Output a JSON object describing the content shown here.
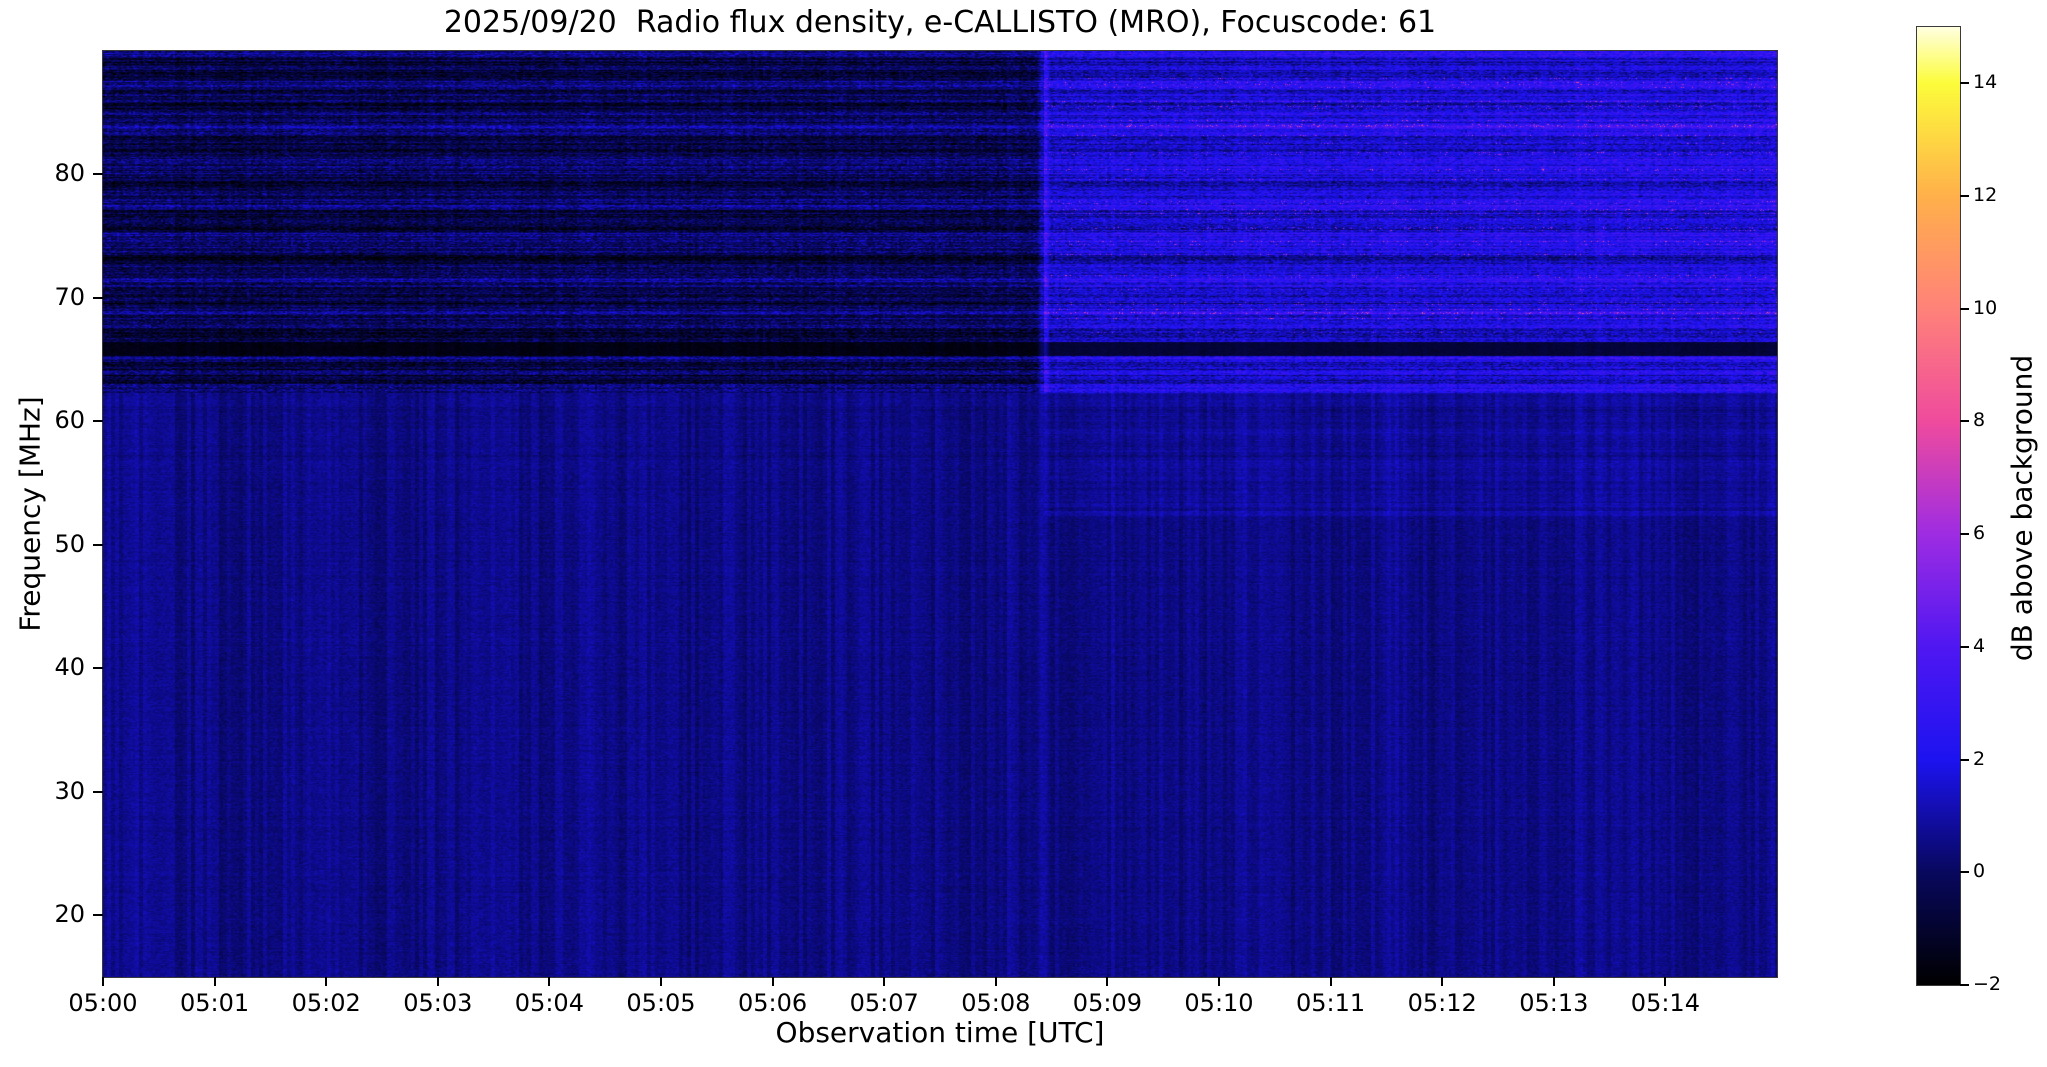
{
  "chart_data": {
    "type": "heatmap",
    "title": "2025/09/20  Radio flux density, e-CALLISTO (MRO), Focuscode: 61",
    "xlabel": "Observation time [UTC]",
    "ylabel": "Frequency [MHz]",
    "x_range_minutes": [
      0,
      15
    ],
    "x_start_time": "05:00",
    "x_ticks": [
      {
        "minute": 0,
        "label": "05:00"
      },
      {
        "minute": 1,
        "label": "05:01"
      },
      {
        "minute": 2,
        "label": "05:02"
      },
      {
        "minute": 3,
        "label": "05:03"
      },
      {
        "minute": 4,
        "label": "05:04"
      },
      {
        "minute": 5,
        "label": "05:05"
      },
      {
        "minute": 6,
        "label": "05:06"
      },
      {
        "minute": 7,
        "label": "05:07"
      },
      {
        "minute": 8,
        "label": "05:08"
      },
      {
        "minute": 9,
        "label": "05:09"
      },
      {
        "minute": 10,
        "label": "05:10"
      },
      {
        "minute": 11,
        "label": "05:11"
      },
      {
        "minute": 12,
        "label": "05:12"
      },
      {
        "minute": 13,
        "label": "05:13"
      },
      {
        "minute": 14,
        "label": "05:14"
      }
    ],
    "freq_range_mhz": [
      15,
      90
    ],
    "y_ticks": [
      {
        "freq": 80,
        "label": "80"
      },
      {
        "freq": 70,
        "label": "70"
      },
      {
        "freq": 60,
        "label": "60"
      },
      {
        "freq": 50,
        "label": "50"
      },
      {
        "freq": 40,
        "label": "40"
      },
      {
        "freq": 30,
        "label": "30"
      },
      {
        "freq": 20,
        "label": "20"
      }
    ],
    "colorbar": {
      "label": "dB above background",
      "min": -2,
      "max": 15,
      "ticks": [
        {
          "value": 14,
          "label": "14"
        },
        {
          "value": 12,
          "label": "12"
        },
        {
          "value": 10,
          "label": "10"
        },
        {
          "value": 8,
          "label": "8"
        },
        {
          "value": 6,
          "label": "6"
        },
        {
          "value": 4,
          "label": "4"
        },
        {
          "value": 2,
          "label": "2"
        },
        {
          "value": 0,
          "label": "0"
        },
        {
          "value": -2,
          "label": "−2"
        }
      ],
      "stops": [
        {
          "value": -2,
          "color": "#000000"
        },
        {
          "value": 0,
          "color": "#08085e"
        },
        {
          "value": 2,
          "color": "#1c13f0"
        },
        {
          "value": 4,
          "color": "#4f17f2"
        },
        {
          "value": 6,
          "color": "#9e2ce2"
        },
        {
          "value": 8,
          "color": "#ef4b9d"
        },
        {
          "value": 10,
          "color": "#ff8279"
        },
        {
          "value": 12,
          "color": "#ffb04a"
        },
        {
          "value": 14,
          "color": "#fcfc3b"
        },
        {
          "value": 15,
          "color": "#ffffe0"
        }
      ]
    },
    "spectrogram": {
      "seed": 7,
      "transition_minute": 8.43,
      "upper_band_min_freq_mhz": 62.3,
      "mid_band_min_freq_mhz": 53.0,
      "dark_line_freq_mhz": 65.85,
      "dark_line_halfwidth_mhz": 0.55,
      "right_bright_row_freq_mhz": 52.55,
      "levels_db": {
        "lower_background": 0.55,
        "upper_left_mean": -0.35,
        "upper_right_mean": 1.6,
        "dark_line_left": -1.55,
        "dark_line_right": -0.8,
        "vertical_line_boost_upper": 1.6,
        "vertical_line_boost_lower": 0.55,
        "right_mid_boost": 0.22,
        "left_time_ramp": 0.22,
        "right_time_ramp": 0.35
      },
      "noise_db": {
        "lower_amp": 0.5,
        "upper_amp": 1.35,
        "stripe_amp": 0.9,
        "column_amp": 0.42
      }
    }
  }
}
